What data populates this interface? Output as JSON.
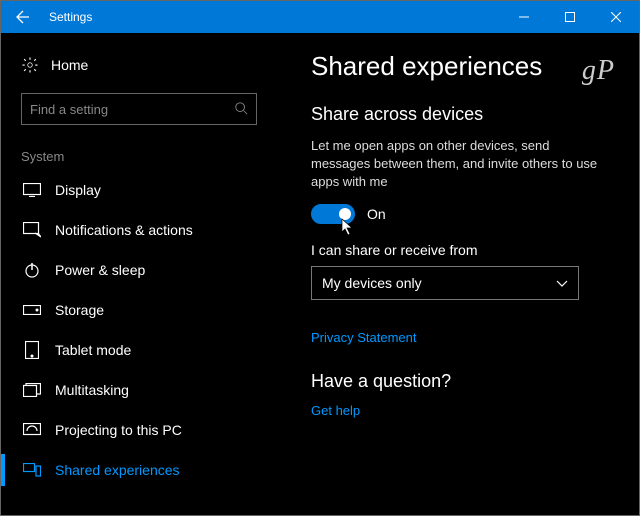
{
  "titlebar": {
    "title": "Settings"
  },
  "sidebar": {
    "home": "Home",
    "search_placeholder": "Find a setting",
    "section": "System",
    "items": [
      {
        "label": "Display"
      },
      {
        "label": "Notifications & actions"
      },
      {
        "label": "Power & sleep"
      },
      {
        "label": "Storage"
      },
      {
        "label": "Tablet mode"
      },
      {
        "label": "Multitasking"
      },
      {
        "label": "Projecting to this PC"
      },
      {
        "label": "Shared experiences"
      }
    ]
  },
  "main": {
    "watermark": "gP",
    "title": "Shared experiences",
    "subtitle": "Share across devices",
    "description": "Let me open apps on other devices, send messages between them, and invite others to use apps with me",
    "toggle_state": "On",
    "share_label": "I can share or receive from",
    "dropdown_value": "My devices only",
    "privacy_link": "Privacy Statement",
    "question_heading": "Have a question?",
    "help_link": "Get help"
  }
}
